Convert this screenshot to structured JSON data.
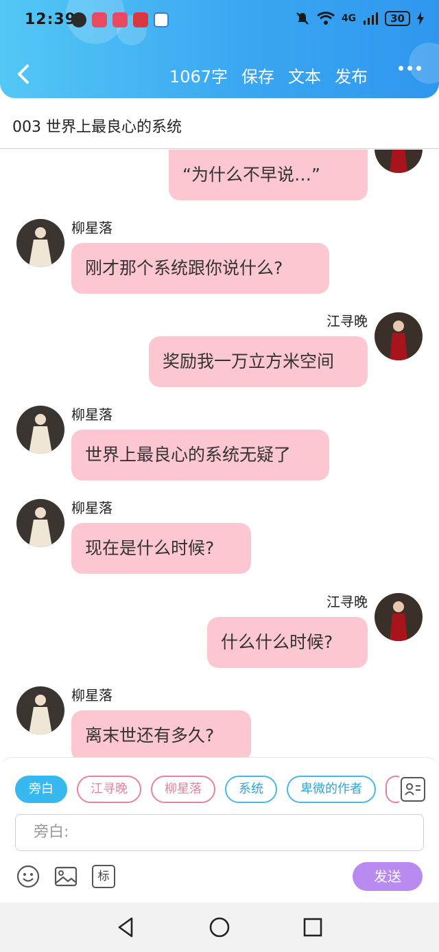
{
  "status_bar": {
    "time": "12:39",
    "battery": "30",
    "signal_label": "4G"
  },
  "toolbar": {
    "word_count": "1067字",
    "save_label": "保存",
    "text_label": "文本",
    "publish_label": "发布"
  },
  "story": {
    "title": "003 世界上最良心的系统"
  },
  "messages": [
    {
      "side": "right",
      "speaker": "",
      "text": "“为什么不早说…”"
    },
    {
      "side": "left",
      "speaker": "柳星落",
      "text": "刚才那个系统跟你说什么?"
    },
    {
      "side": "right",
      "speaker": "江寻晚",
      "text": "奖励我一万立方米空间"
    },
    {
      "side": "left",
      "speaker": "柳星落",
      "text": "世界上最良心的系统无疑了"
    },
    {
      "side": "left",
      "speaker": "柳星落",
      "text": "现在是什么时候?"
    },
    {
      "side": "right",
      "speaker": "江寻晚",
      "text": "什么什么时候?"
    },
    {
      "side": "left",
      "speaker": "柳星落",
      "text": "离末世还有多久?"
    }
  ],
  "roles": [
    {
      "label": "旁白",
      "style": "active"
    },
    {
      "label": "江寻晚",
      "style": "pink"
    },
    {
      "label": "柳星落",
      "style": "pink"
    },
    {
      "label": "系统",
      "style": "blue"
    },
    {
      "label": "卑微的作者",
      "style": "blue"
    }
  ],
  "composer": {
    "placeholder": "旁白:",
    "send_label": "发送",
    "tag_label": "标"
  },
  "colors": {
    "header_start": "#53c8f5",
    "header_end": "#2f97ee",
    "bubble": "#fdc7d2",
    "send": "#b98af0",
    "chip_active": "#37b8ef",
    "chip_pink": "#e9819a",
    "chip_blue": "#45b9e5"
  },
  "icons": {
    "back": "chevron-left-icon",
    "more": "more-dots-icon",
    "contacts": "contact-card-icon",
    "emoji": "smile-icon",
    "image": "image-icon",
    "tag": "tag-icon",
    "sys_back": "triangle-back-icon",
    "sys_home": "circle-home-icon",
    "sys_recent": "square-recent-icon"
  }
}
